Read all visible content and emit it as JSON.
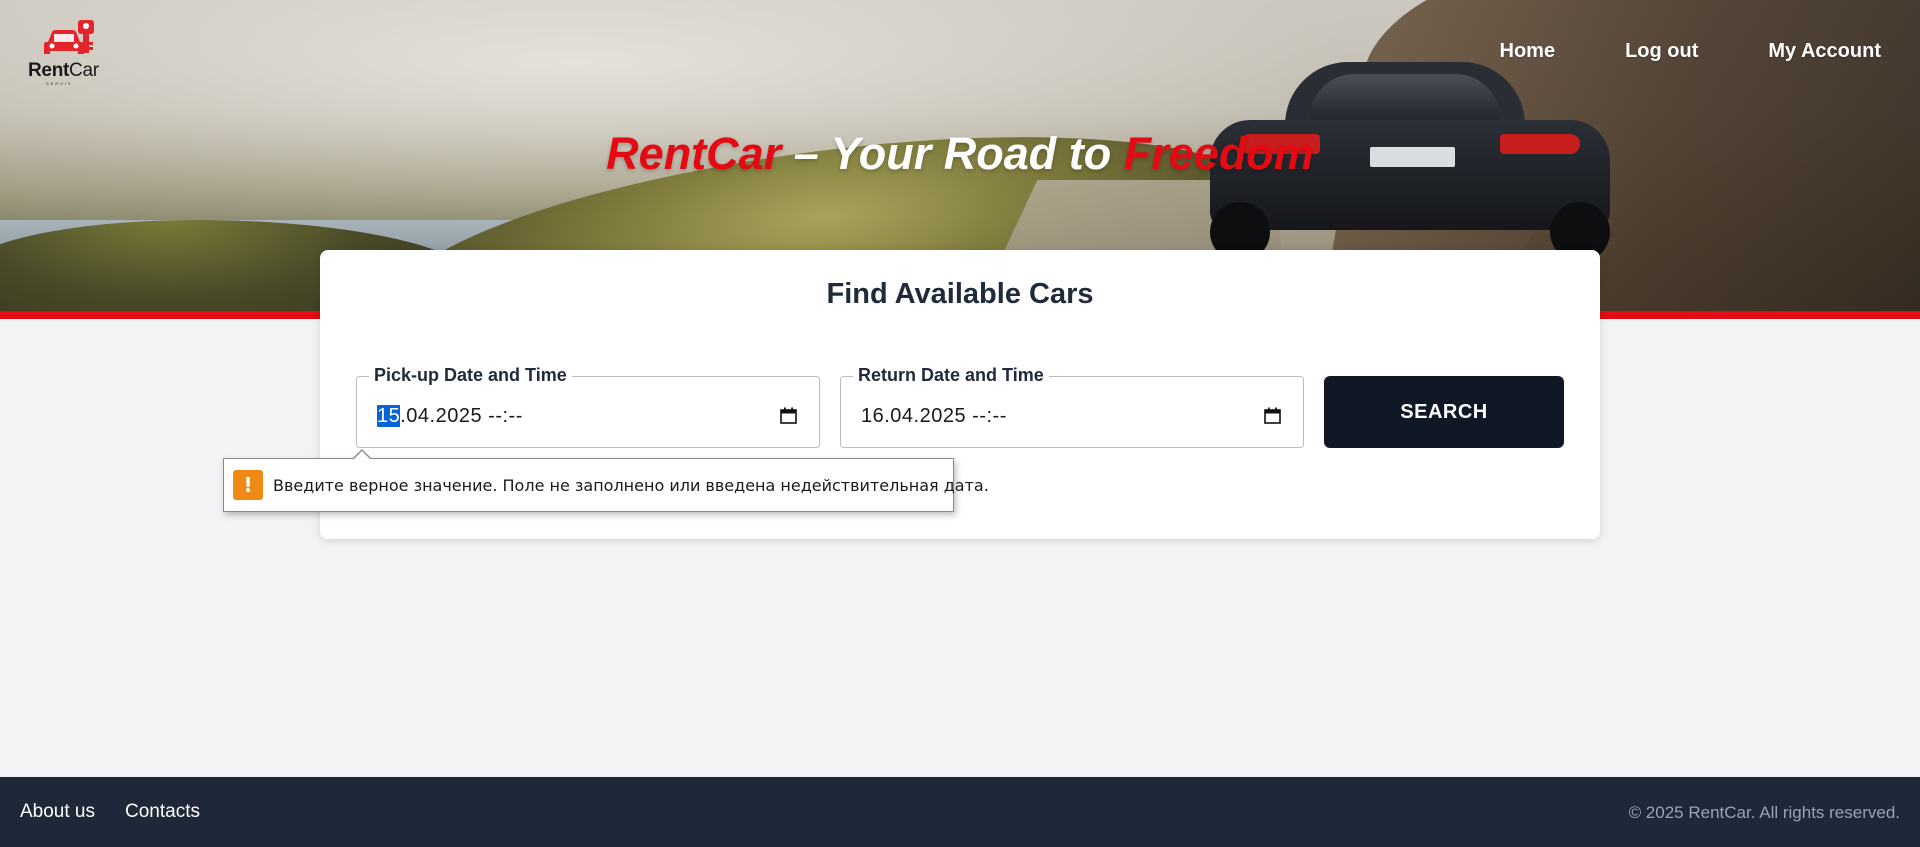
{
  "header": {
    "logo": {
      "text_bold": "Rent",
      "text_light": "Car",
      "subtitle": "SERVIS"
    },
    "nav": [
      "Home",
      "Log out",
      "My Account"
    ]
  },
  "hero": {
    "title_part1": "RentCar",
    "title_part2": " – Your Road to ",
    "title_part3": "Freedom"
  },
  "search_card": {
    "title": "Find Available Cars",
    "pickup": {
      "label": "Pick-up Date and Time",
      "day_selected": "15",
      "value_rest": ".04.2025 --:--"
    },
    "return": {
      "label": "Return Date and Time",
      "value": "16.04.2025 --:--"
    },
    "search_button": "SEARCH"
  },
  "validation_tooltip": {
    "icon": "!",
    "message": "Введите верное значение. Поле не заполнено или введена недействительная дата."
  },
  "footer": {
    "links": [
      "About us",
      "Contacts"
    ],
    "copyright": "© 2025 RentCar. All rights reserved."
  },
  "colors": {
    "accent_red": "#e30b13",
    "dark_navy": "#101826",
    "footer_bg": "#1e2839",
    "warning_orange": "#f08a16",
    "selection_blue": "#0a63d6"
  }
}
